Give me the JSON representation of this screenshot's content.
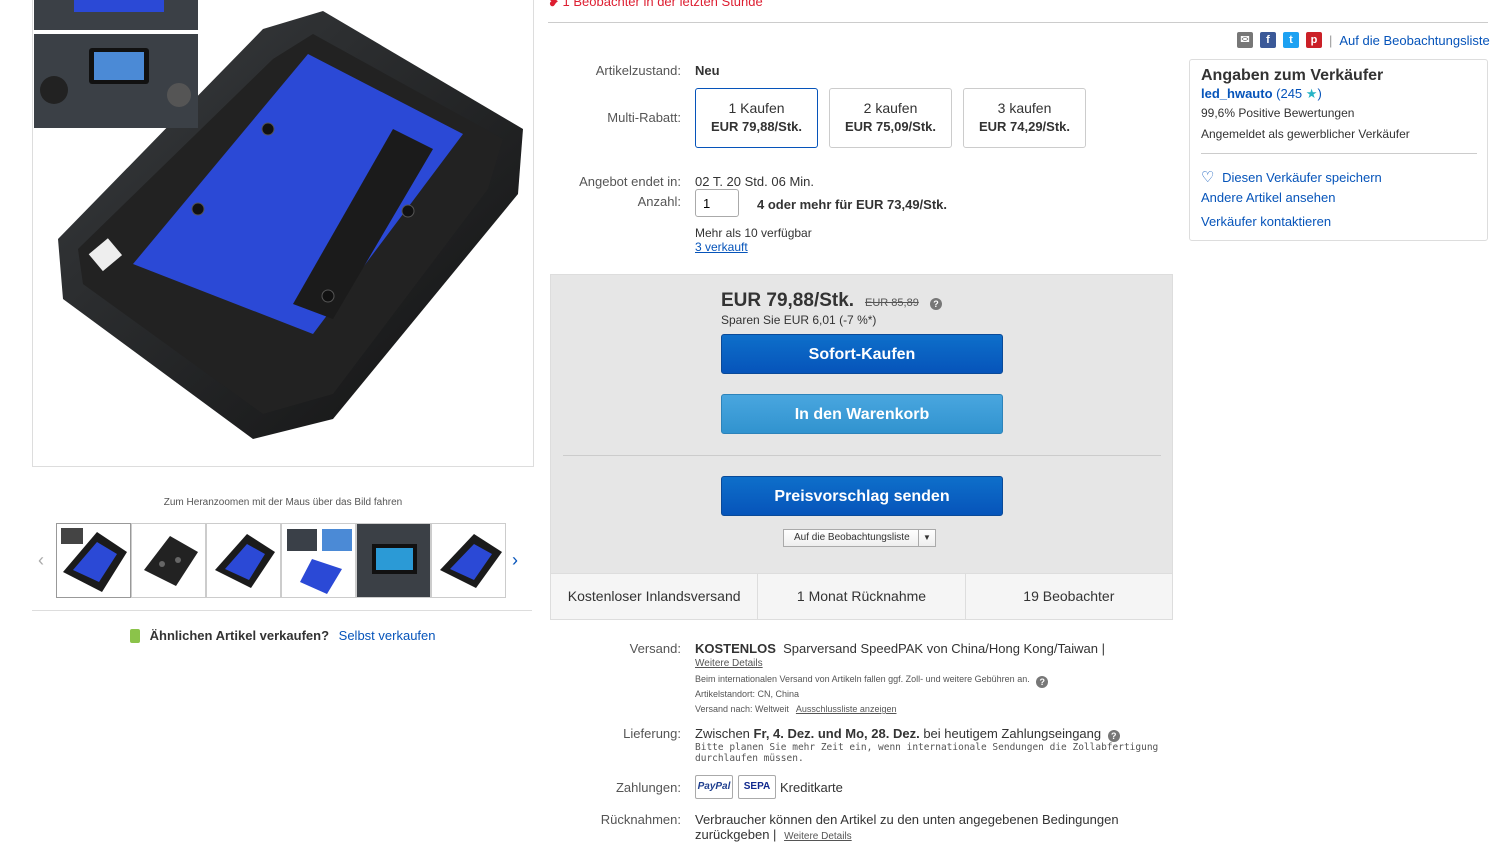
{
  "top": {
    "watchers_text": "1 Beobachter in der letzten Stunde"
  },
  "gallery": {
    "zoom_hint": "Zum Heranzoomen mit der Maus über das Bild fahren",
    "prev_icon": "‹",
    "next_icon": "›",
    "sell_question": "Ähnlichen Artikel verkaufen?",
    "sell_link": "Selbst verkaufen"
  },
  "item": {
    "condition_label": "Artikelzustand:",
    "condition_value": "Neu",
    "multi_label": "Multi-Rabatt:",
    "multi_options": [
      {
        "qty": "1 Kaufen",
        "price": "EUR 79,88/Stk."
      },
      {
        "qty": "2 kaufen",
        "price": "EUR 75,09/Stk."
      },
      {
        "qty": "3 kaufen",
        "price": "EUR 74,29/Stk."
      }
    ],
    "ends_label": "Angebot endet in:",
    "ends_value": "02 T. 20 Std. 06 Min.",
    "qty_label": "Anzahl:",
    "qty_value": "1",
    "qty_deal": "4 oder mehr für EUR 73,49/Stk.",
    "available": "Mehr als 10 verfügbar",
    "sold": "3 verkauft"
  },
  "buybox": {
    "price": "EUR 79,88/Stk.",
    "orig_price": "EUR 85,89",
    "savings": "Sparen Sie EUR 6,01 (-7 %*)",
    "buy_now": "Sofort-Kaufen",
    "add_cart": "In den Warenkorb",
    "offer": "Preisvorschlag senden",
    "watch": "Auf die Beobachtungsliste",
    "strip": [
      "Kostenloser Inlandsversand",
      "1 Monat Rücknahme",
      "19 Beobachter"
    ]
  },
  "shipping": {
    "label": "Versand:",
    "free": "KOSTENLOS",
    "method": "Sparversand SpeedPAK von China/Hong Kong/Taiwan |",
    "details_link": "Weitere Details",
    "intl_note": "Beim internationalen Versand von Artikeln fallen ggf. Zoll- und weitere Gebühren an.",
    "location": "Artikelstandort:  CN, China",
    "ships_to_label": "Versand nach:  Weltweit",
    "exclusion_link": "Ausschlussliste anzeigen"
  },
  "delivery": {
    "label": "Lieferung:",
    "text_prefix": "Zwischen",
    "dates": "Fr, 4. Dez. und Mo, 28. Dez.",
    "text_suffix": "bei heutigem Zahlungseingang",
    "note_line1": "Bitte planen Sie mehr Zeit ein, wenn internationale Sendungen die Zollabfertigung",
    "note_line2": "durchlaufen müssen."
  },
  "payments": {
    "label": "Zahlungen:",
    "paypal": "PayPal",
    "sepa": "SEPA",
    "card": "Kreditkarte"
  },
  "returns": {
    "label": "Rücknahmen:",
    "line1": "Verbraucher können den Artikel zu den unten angegebenen Bedingungen",
    "line2": "zurückgeben |",
    "details_link": "Weitere Details"
  },
  "seller": {
    "watchlist_link": "Auf die Beobachtungsliste",
    "title": "Angaben zum Verkäufer",
    "name": "led_hwauto",
    "score": "(245",
    "score_close": ")",
    "positive": "99,6% Positive Bewertungen",
    "registered": "Angemeldet als gewerblicher Verkäufer",
    "save": "Diesen Verkäufer speichern",
    "other_items": "Andere Artikel ansehen",
    "contact": "Verkäufer kontaktieren"
  },
  "colors": {
    "link": "#0654ba",
    "alert": "#dd1e31",
    "product_blue": "#2b49d6"
  }
}
